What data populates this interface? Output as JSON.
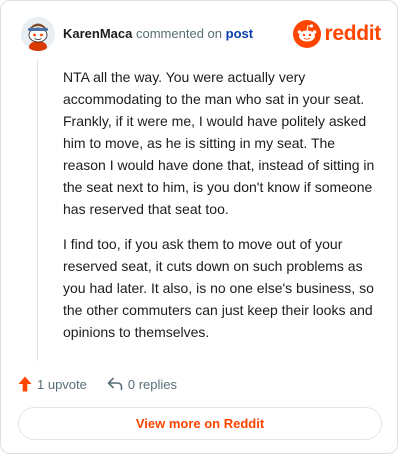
{
  "header": {
    "author": "KarenMaca",
    "action_text": "commented on",
    "post_link": "post",
    "brand_name": "reddit"
  },
  "comment": {
    "paragraphs": [
      "NTA all the way. You were actually very accommodating to the man who sat in your seat. Frankly, if it were me, I would have politely asked him to move, as he is sitting in my seat. The reason I would have done that, instead of sitting in the seat next to him, is you don't know if someone has reserved that seat too.",
      "I find too, if you ask them to move out of your reserved seat, it cuts down on such problems as you had later. It also, is no one else's business, so the other commuters can just keep their looks and opinions to themselves."
    ]
  },
  "actions": {
    "upvotes": "1 upvote",
    "replies": "0 replies"
  },
  "cta": {
    "label": "View more on Reddit"
  },
  "icons": {
    "avatar": "snoo-avatar-icon",
    "brand": "reddit-logo-icon",
    "upvote": "upvote-arrow-icon",
    "reply": "reply-arrow-icon"
  },
  "colors": {
    "brand": "#ff4500",
    "link": "#0b3eaf",
    "muted": "#576f76"
  }
}
